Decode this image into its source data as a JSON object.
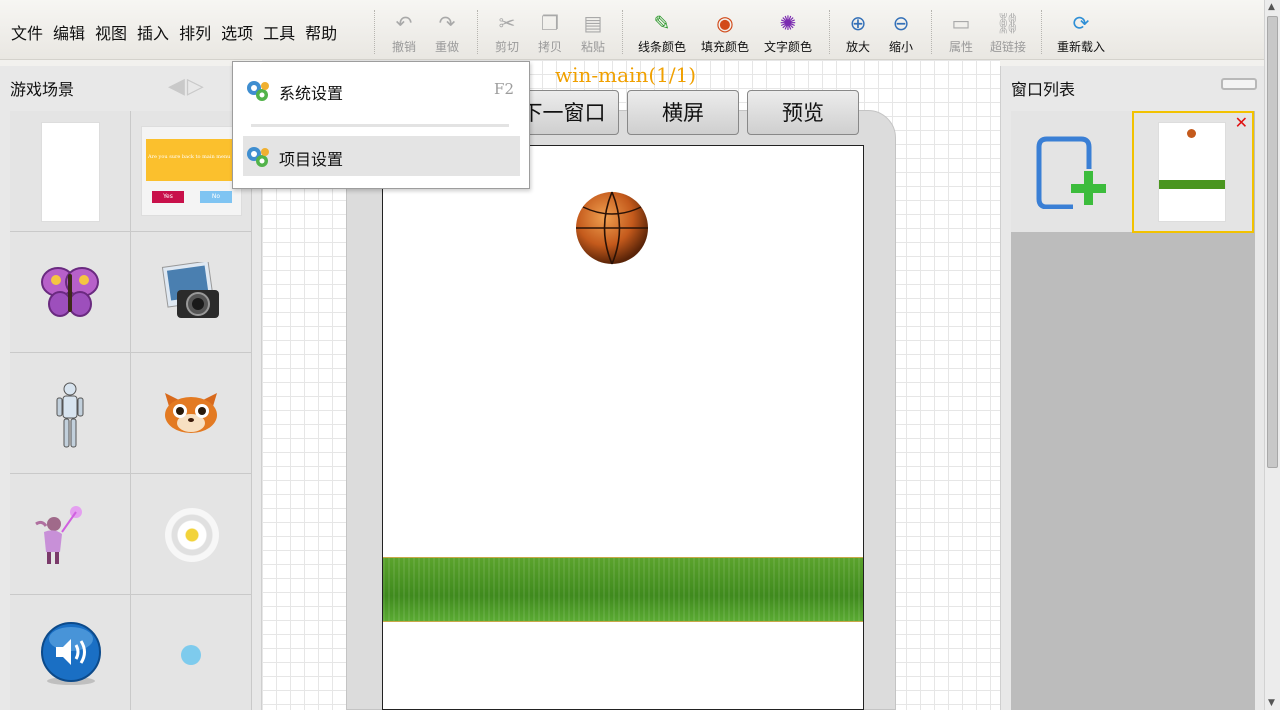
{
  "menu": [
    "文件",
    "编辑",
    "视图",
    "插入",
    "排列",
    "选项",
    "工具",
    "帮助"
  ],
  "toolbar": {
    "undo": "撤销",
    "redo": "重做",
    "cut": "剪切",
    "copy": "拷贝",
    "paste": "粘贴",
    "line_color": "线条颜色",
    "fill_color": "填充颜色",
    "text_color": "文字颜色",
    "zoom_in": "放大",
    "zoom_out": "缩小",
    "properties": "属性",
    "hyperlink": "超链接",
    "reload": "重新载入"
  },
  "left_panel": {
    "title": "游戏场景",
    "assets": [
      {
        "name": "blank-page"
      },
      {
        "name": "dialog-thumbnail",
        "text": "Are you sure back to main menu",
        "yes": "Yes",
        "no": "No"
      },
      {
        "name": "butterfly"
      },
      {
        "name": "camera-photo"
      },
      {
        "name": "robot-figure"
      },
      {
        "name": "fox-face"
      },
      {
        "name": "fairy-character"
      },
      {
        "name": "radial-ring"
      },
      {
        "name": "speaker-volume"
      },
      {
        "name": "blue-dot"
      }
    ]
  },
  "dropdown": {
    "items": [
      {
        "label": "系统设置",
        "shortcut": "F2"
      },
      {
        "label": "项目设置",
        "shortcut": ""
      }
    ]
  },
  "editor": {
    "window_title": "win-main(1/1)",
    "buttons": {
      "next_window": "下一窗口",
      "landscape": "横屏",
      "preview": "预览"
    }
  },
  "right_panel": {
    "title": "窗口列表"
  },
  "colors": {
    "accent_orange": "#f0a000",
    "selected_tile_border": "#f2c200",
    "add_icon_blue": "#3a7fd5",
    "add_icon_green": "#3cbc3c",
    "close_red": "#e01010"
  }
}
